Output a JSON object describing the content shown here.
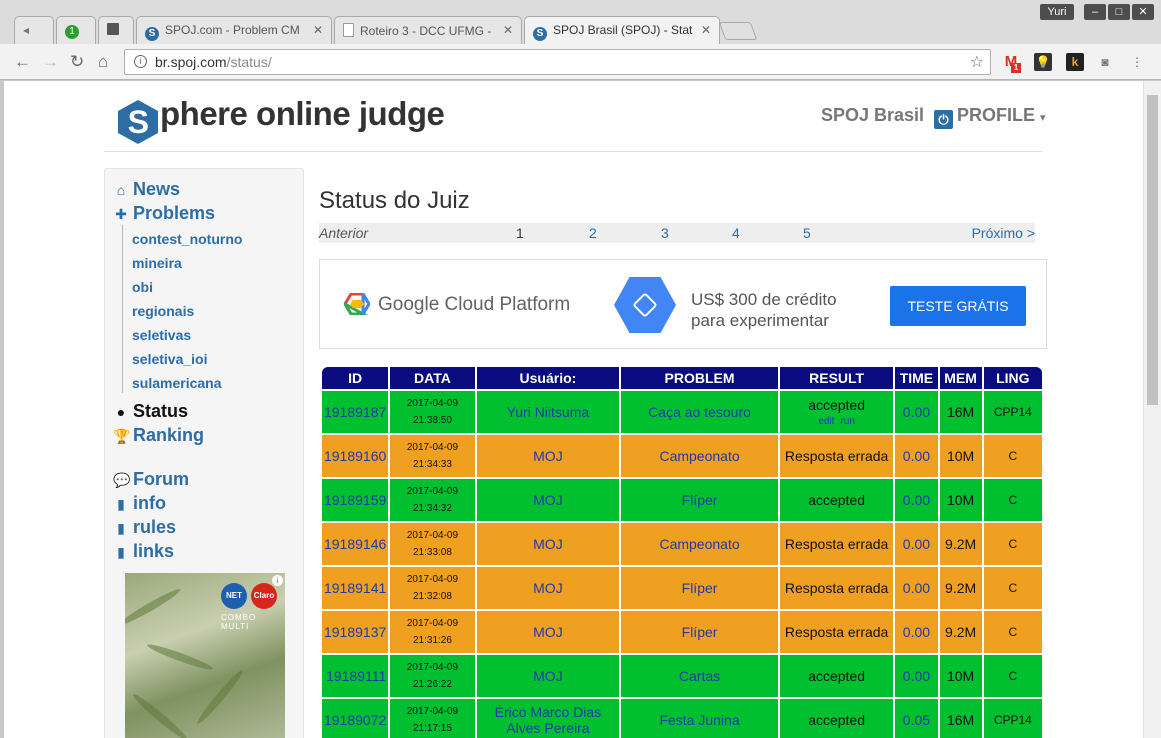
{
  "browser": {
    "tabs": [
      {
        "title": "SPOJ.com - Problem CM",
        "favicon": "S"
      },
      {
        "title": "Roteiro 3 - DCC UFMG -",
        "favicon": "doc"
      },
      {
        "title": "SPOJ Brasil (SPOJ) - Stat",
        "favicon": "S"
      }
    ],
    "pinned_badge": "1",
    "user": "Yuri",
    "url_host": "br.spoj.com",
    "url_path": "/status/",
    "gmail_badge": "1"
  },
  "site": {
    "logo_letter": "S",
    "logo_text": "phere online judge",
    "brand": "SPOJ Brasil",
    "profile": "PROFILE"
  },
  "sidebar": {
    "news": "News",
    "problems": "Problems",
    "categories": [
      "contest_noturno",
      "mineira",
      "obi",
      "regionais",
      "seletivas",
      "seletiva_ioi",
      "sulamericana"
    ],
    "status": "Status",
    "ranking": "Ranking",
    "forum": "Forum",
    "info": "info",
    "rules": "rules",
    "links": "links",
    "ad": {
      "brand1": "NET",
      "brand2": "Claro",
      "tag": "COMBO MULTI"
    }
  },
  "main": {
    "title": "Status do Juiz",
    "pager": {
      "prev": "Anterior",
      "current": "1",
      "pages": [
        "2",
        "3",
        "4",
        "5"
      ],
      "next": "Próximo >"
    }
  },
  "ad": {
    "name": "Google Cloud Platform",
    "line1": "US$ 300 de crédito",
    "line2": "para experimentar",
    "button": "TESTE GRÁTIS"
  },
  "table": {
    "headers": [
      "ID",
      "DATA",
      "Usuário:",
      "PROBLEM",
      "RESULT",
      "TIME",
      "MEM",
      "LING"
    ],
    "rows": [
      {
        "id": "19189187",
        "date": "2017-04-09",
        "time": "21:38:50",
        "user": "Yuri Niitsuma",
        "problem": "Caça ao tesouro",
        "result": "accepted",
        "extra": [
          "edit",
          "run"
        ],
        "t": "0.00",
        "mem": "16M",
        "lang": "CPP14",
        "ok": true
      },
      {
        "id": "19189160",
        "date": "2017-04-09",
        "time": "21:34:33",
        "user": "MOJ",
        "problem": "Campeonato",
        "result": "Resposta errada",
        "t": "0.00",
        "mem": "10M",
        "lang": "C",
        "ok": false
      },
      {
        "id": "19189159",
        "date": "2017-04-09",
        "time": "21:34:32",
        "user": "MOJ",
        "problem": "Flíper",
        "result": "accepted",
        "t": "0.00",
        "mem": "10M",
        "lang": "C",
        "ok": true
      },
      {
        "id": "19189146",
        "date": "2017-04-09",
        "time": "21:33:08",
        "user": "MOJ",
        "problem": "Campeonato",
        "result": "Resposta errada",
        "t": "0.00",
        "mem": "9.2M",
        "lang": "C",
        "ok": false
      },
      {
        "id": "19189141",
        "date": "2017-04-09",
        "time": "21:32:08",
        "user": "MOJ",
        "problem": "Flíper",
        "result": "Resposta errada",
        "t": "0.00",
        "mem": "9.2M",
        "lang": "C",
        "ok": false
      },
      {
        "id": "19189137",
        "date": "2017-04-09",
        "time": "21:31:26",
        "user": "MOJ",
        "problem": "Flíper",
        "result": "Resposta errada",
        "t": "0.00",
        "mem": "9.2M",
        "lang": "C",
        "ok": false
      },
      {
        "id": "19189111",
        "date": "2017-04-09",
        "time": "21:26:22",
        "user": "MOJ",
        "problem": "Cartas",
        "result": "accepted",
        "t": "0.00",
        "mem": "10M",
        "lang": "C",
        "ok": true
      },
      {
        "id": "19189072",
        "date": "2017-04-09",
        "time": "21:17:15",
        "user": "Érico Marco Dias Alves Pereira",
        "problem": "Festa Junina",
        "result": "accepted",
        "t": "0.05",
        "mem": "16M",
        "lang": "CPP14",
        "ok": true
      }
    ]
  }
}
